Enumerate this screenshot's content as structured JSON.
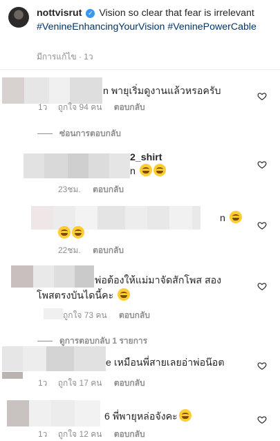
{
  "caption": {
    "username": "nottvisrut",
    "text": "Vision so clear that fear is irrelevant",
    "hashtags": [
      "#VenineEnhancingYourVision",
      "#VeninePowerCable"
    ],
    "meta": "มีการแก้ไข · 1ว"
  },
  "comments": [
    {
      "text": "n พายุเริ่มดูงานแล้วหรอครับ",
      "time": "1ว",
      "likes": "ถูกใจ 94 คน",
      "reply": "ตอบกลับ"
    },
    {
      "text_line1": "2_shirt",
      "text_line2": "n",
      "time": "23ชม.",
      "reply": "ตอบกลับ"
    },
    {
      "text": "n",
      "time": "22ชม.",
      "reply": "ตอบกลับ"
    },
    {
      "text_line1": "พ่อต้องให้แม่มาจัดสักโพส สอง",
      "text_line2": "โพสตรงบันไดนี้คะ",
      "likes": "ถูกใจ 73 คน",
      "reply": "ตอบกลับ"
    },
    {
      "text": "e เหมือนพี่สายเลยอ่าพ่อน๊อต",
      "time": "1ว",
      "likes": "ถูกใจ 17 คน",
      "reply": "ตอบกลับ"
    },
    {
      "text": "6 พี่พายุหล่อจังคะ",
      "time": "1ว",
      "likes": "ถูกใจ 12 คน",
      "reply": "ตอบกลับ"
    }
  ],
  "threads": {
    "hide_replies": "ซ่อนการตอบกลับ",
    "view_replies": "ดูการตอบกลับ 1 รายการ"
  },
  "icons": {
    "like": "heart-outline-icon",
    "verified": "verified-badge-icon",
    "emoji": "laughing-emoji-icon"
  },
  "colors": {
    "hashtag": "#003569",
    "meta": "#8e8e8e",
    "verified": "#3897f0"
  }
}
